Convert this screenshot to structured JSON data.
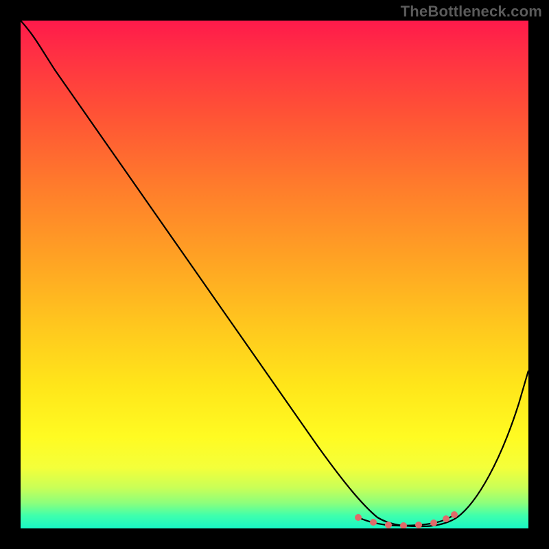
{
  "watermark": "TheBottleneck.com",
  "colors": {
    "curve": "#000000",
    "accent": "#e06a6a",
    "gradient_top": "#ff1a4b",
    "gradient_bottom": "#18f7c5",
    "frame": "#000000"
  },
  "chart_data": {
    "type": "line",
    "title": "",
    "xlabel": "",
    "ylabel": "",
    "xlim": [
      0,
      100
    ],
    "ylim": [
      0,
      100
    ],
    "grid": false,
    "legend": false,
    "note": "x normalized 0-100 left→right, y normalized 0-100 bottom→top; values are visual estimates",
    "series": [
      {
        "name": "bottleneck-curve",
        "x": [
          0,
          4,
          10,
          20,
          30,
          40,
          50,
          58,
          63,
          66,
          70,
          74,
          78,
          82,
          86,
          90,
          94,
          98,
          100
        ],
        "y": [
          100,
          97,
          90,
          77,
          64,
          51,
          38,
          26,
          17,
          10,
          4,
          1,
          0.5,
          0.5,
          1,
          6,
          14,
          26,
          33
        ]
      }
    ],
    "highlight_segment": {
      "name": "minimum-flat-region",
      "x": [
        66,
        70,
        74,
        78,
        82,
        84
      ],
      "y": [
        2.2,
        1.2,
        0.8,
        0.8,
        1.0,
        1.6
      ]
    }
  }
}
